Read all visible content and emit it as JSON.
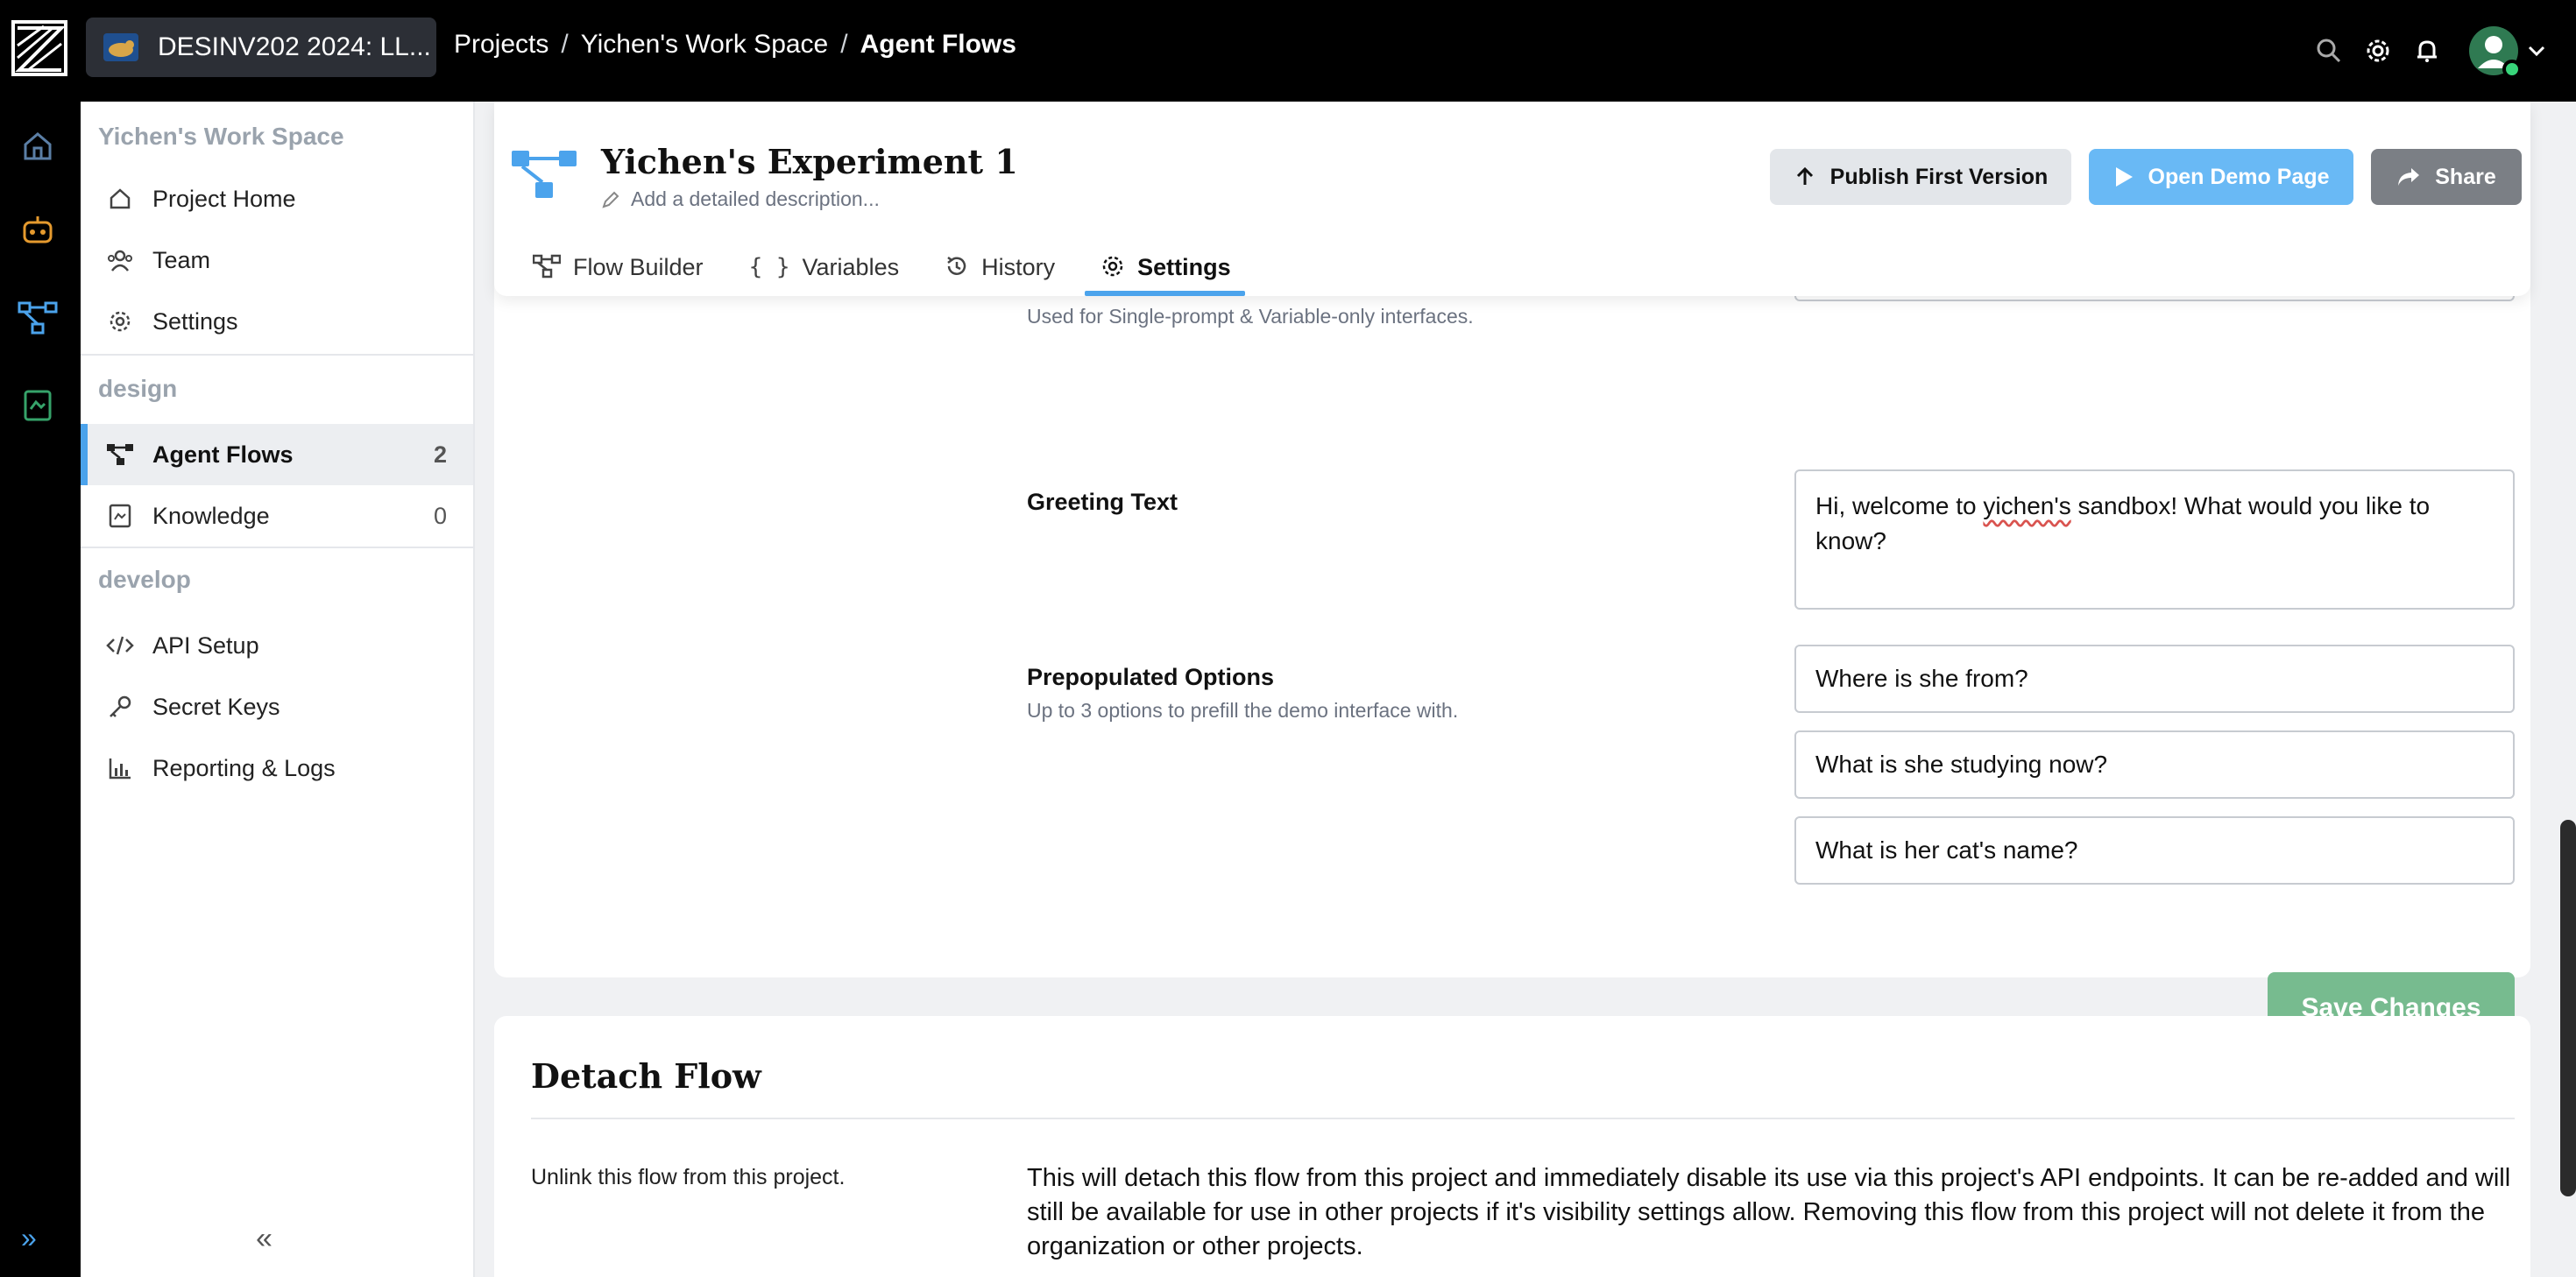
{
  "topbar": {
    "project_switcher": "DESINV202 2024: LL...",
    "breadcrumbs": [
      "Projects",
      "Yichen's Work Space",
      "Agent Flows"
    ],
    "separator": "/"
  },
  "sidebar": {
    "workspace": "Yichen's Work Space",
    "items_top": [
      {
        "label": "Project Home",
        "icon": "home-icon"
      },
      {
        "label": "Team",
        "icon": "team-icon"
      },
      {
        "label": "Settings",
        "icon": "gear-icon"
      }
    ],
    "design_label": "design",
    "design_items": [
      {
        "label": "Agent Flows",
        "count": "2",
        "icon": "flow-icon"
      },
      {
        "label": "Knowledge",
        "count": "0",
        "icon": "knowledge-icon"
      }
    ],
    "develop_label": "develop",
    "develop_items": [
      {
        "label": "API Setup",
        "icon": "code-icon"
      },
      {
        "label": "Secret Keys",
        "icon": "key-icon"
      },
      {
        "label": "Reporting & Logs",
        "icon": "chart-icon"
      }
    ],
    "collapse": "«"
  },
  "rail": {
    "expand": "»"
  },
  "header": {
    "title": "Yichen's Experiment 1",
    "description_placeholder": "Add a detailed description...",
    "publish_label": "Publish First Version",
    "demo_label": "Open Demo Page",
    "share_label": "Share",
    "tabs": [
      {
        "label": "Flow Builder"
      },
      {
        "label": "Variables"
      },
      {
        "label": "History"
      },
      {
        "label": "Settings"
      }
    ]
  },
  "settings": {
    "top_hint": "Used for Single-prompt & Variable-only interfaces.",
    "greeting_label": "Greeting Text",
    "greeting_value_pre": "Hi, welcome to ",
    "greeting_value_misspelled": "yichen's",
    "greeting_value_post": " sandbox! What would you like to know?",
    "prepop_label": "Prepopulated Options",
    "prepop_hint": "Up to 3 options to prefill the demo interface with.",
    "options": [
      "Where is she from?",
      "What is she studying now?",
      "What is her cat's name?"
    ],
    "save_label": "Save Changes"
  },
  "detach": {
    "title": "Detach Flow",
    "left_text": "Unlink this flow from this project.",
    "body": "This will detach this flow from this project and immediately disable its use via this project's API endpoints. It can be re-added and will still be available for use in other projects if it's visibility settings allow. Removing this flow from this project will not delete it from the organization or other projects."
  },
  "colors": {
    "accent": "#4ba3ec",
    "save_green": "#77bb8f",
    "demo_blue": "#69b9f5",
    "share_gray": "#7b7f85"
  }
}
